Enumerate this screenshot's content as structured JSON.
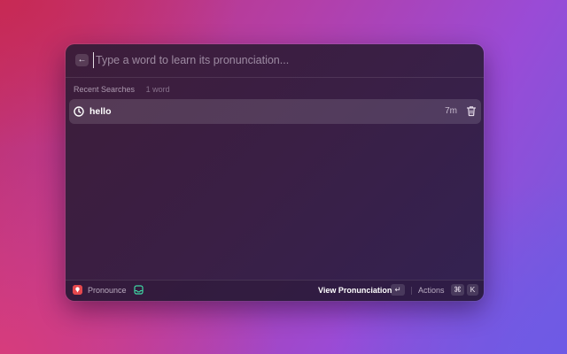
{
  "search": {
    "back_icon": "arrow-left-icon",
    "placeholder": "Type a word to learn its pronunciation..."
  },
  "section": {
    "title": "Recent Searches",
    "count": "1 word"
  },
  "items": [
    {
      "icon": "clock-icon",
      "title": "hello",
      "time": "7m",
      "action_icon": "trash-icon"
    }
  ],
  "footer": {
    "extension_icon": "pronounce-app-icon",
    "title": "Pronounce",
    "status_icon": "inbox-icon",
    "primary_action": "View Pronunciation",
    "primary_key": "↵",
    "actions_label": "Actions",
    "actions_keys": [
      "⌘",
      "K"
    ]
  },
  "colors": {
    "extension_icon_bg": "#e5484d",
    "status_icon": "#3fd7a4"
  }
}
